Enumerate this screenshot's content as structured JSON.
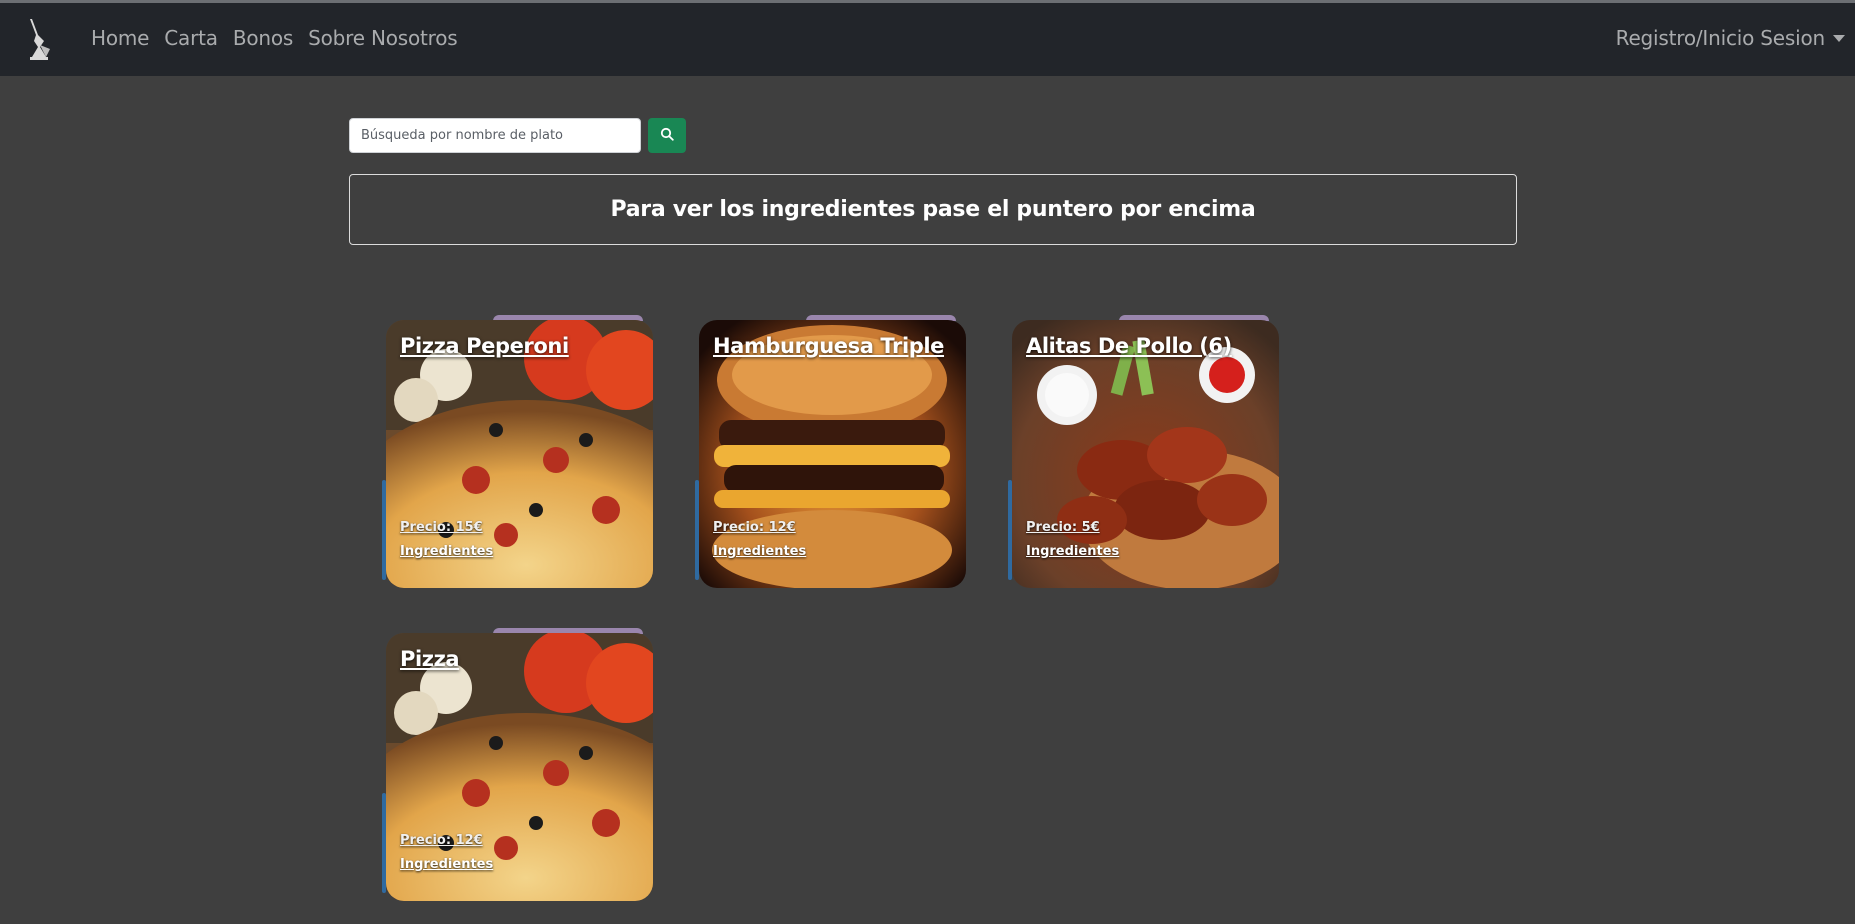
{
  "nav": {
    "brand_icon": "bottle-logo-icon",
    "links": [
      "Home",
      "Carta",
      "Bonos",
      "Sobre Nosotros"
    ],
    "account_label": "Registro/Inicio Sesion"
  },
  "search": {
    "placeholder": "Búsqueda por nombre de plato",
    "button_icon": "search-icon",
    "button_color": "#198754"
  },
  "info": {
    "text": "Para ver los ingredientes pase el puntero por encima"
  },
  "dishes": [
    {
      "name": "Pizza Peperoni",
      "price": "Precio: 15€",
      "ingredients_label": "Ingredientes",
      "image": "pizza"
    },
    {
      "name": "Hamburguesa Triple",
      "price": "Precio: 12€",
      "ingredients_label": "Ingredientes",
      "image": "burger"
    },
    {
      "name": "Alitas De Pollo (6)",
      "price": "Precio: 5€",
      "ingredients_label": "Ingredientes",
      "image": "wings"
    },
    {
      "name": "Pizza",
      "price": "Precio: 12€",
      "ingredients_label": "Ingredientes",
      "image": "pizza"
    }
  ],
  "colors": {
    "background": "#3f3f3f",
    "navbar": "#22252a",
    "nav_text": "#a9abad"
  }
}
